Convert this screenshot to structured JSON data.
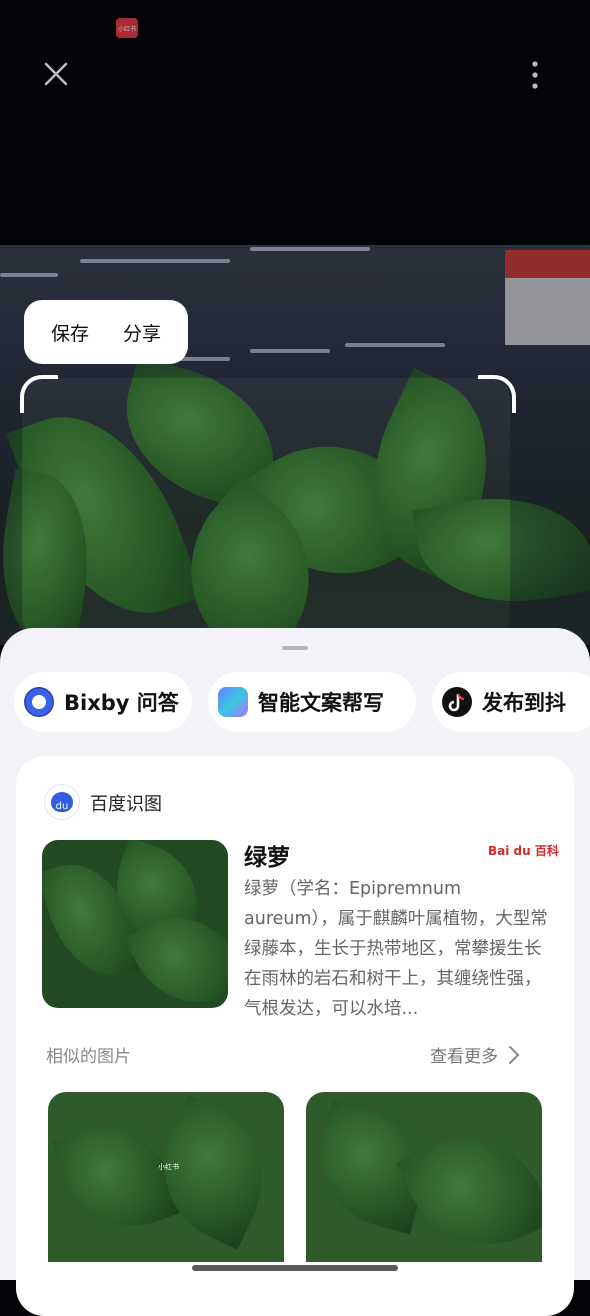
{
  "status": {
    "app_badge": "小红书"
  },
  "toolbar": {
    "close_icon": "close-icon",
    "more_icon": "more-vertical-icon"
  },
  "photo_actions": {
    "save_label": "保存",
    "share_label": "分享"
  },
  "chips": [
    {
      "label": "Bixby 问答",
      "icon": "bixby-icon"
    },
    {
      "label": "智能文案帮写",
      "icon": "ai-writing-icon"
    },
    {
      "label": "发布到抖",
      "icon": "douyin-icon"
    }
  ],
  "result_card": {
    "source_label": "百度识图",
    "plant_name": "绿萝",
    "baike_label": "Bai du 百科",
    "description": "绿萝（学名：Epipremnum aureum），属于麒麟叶属植物，大型常绿藤本，生长于热带地区，常攀援生长在雨林的岩石和树干上，其缠绕性强，气根发达，可以水培...",
    "similar_label": "相似的图片",
    "see_more_label": "查看更多",
    "gallery_watermark": "小红书"
  }
}
